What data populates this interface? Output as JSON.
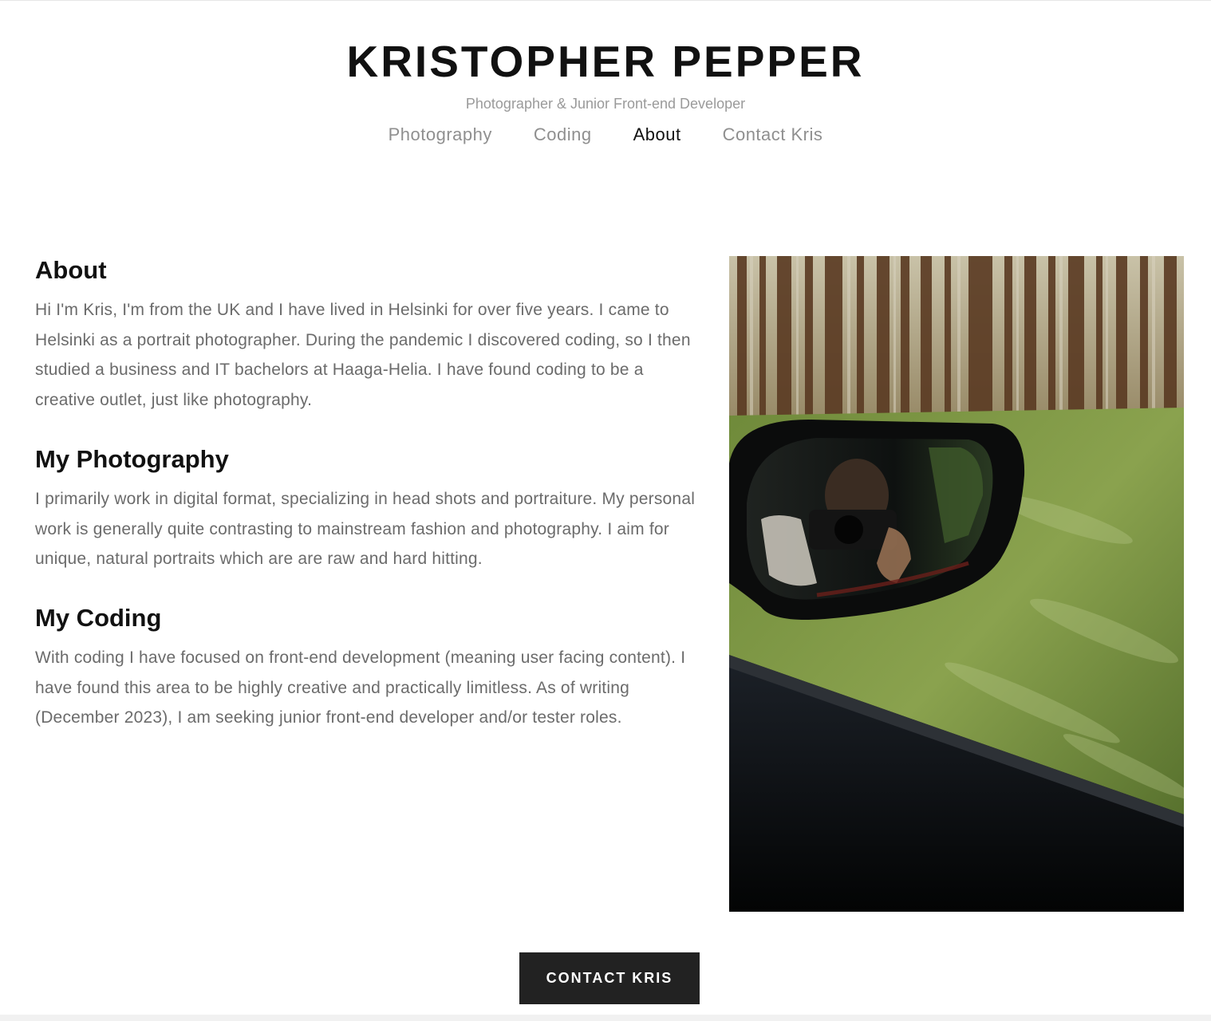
{
  "header": {
    "title": "KRISTOPHER PEPPER",
    "subtitle": "Photographer & Junior Front-end Developer"
  },
  "nav": {
    "items": [
      {
        "label": "Photography",
        "active": false
      },
      {
        "label": "Coding",
        "active": false
      },
      {
        "label": "About",
        "active": true
      },
      {
        "label": "Contact Kris",
        "active": false
      }
    ]
  },
  "sections": {
    "about": {
      "heading": "About",
      "body": "Hi I'm Kris, I'm from the UK and I have lived in Helsinki for over five years. I came to Helsinki as a portrait photographer. During the pandemic I discovered coding, so I then studied a business and IT bachelors at Haaga-Helia. I have found coding to be a creative outlet, just like photography."
    },
    "photography": {
      "heading": "My Photography",
      "body": "I primarily work in digital format, specializing in head shots and portraiture. My personal work is generally quite contrasting to mainstream fashion and photography. I aim for unique, natural portraits which are are raw and hard hitting."
    },
    "coding": {
      "heading": "My Coding",
      "body": "With coding I have focused on front-end development (meaning user facing content). I have found this area to be highly creative and practically limitless. As of writing (December 2023), I am seeking junior front-end developer and/or tester roles."
    }
  },
  "cta": {
    "label": "CONTACT KRIS"
  }
}
